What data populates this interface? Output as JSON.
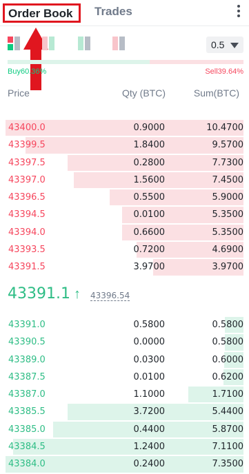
{
  "tabs": {
    "order_book": "Order Book",
    "trades": "Trades"
  },
  "tick_size": "0.5",
  "ratio": {
    "buy_label": "Buy60.36%",
    "sell_label": "Sell39.64%",
    "buy_pct": 60.36,
    "sell_pct": 39.64
  },
  "columns": {
    "price": "Price",
    "qty": "Qty (BTC)",
    "sum": "Sum(BTC)"
  },
  "asks": [
    {
      "price": "43400.0",
      "qty": "0.9000",
      "sum": "10.4700",
      "depth": 1.0
    },
    {
      "price": "43399.5",
      "qty": "1.8400",
      "sum": "9.5700",
      "depth": 0.915
    },
    {
      "price": "43397.5",
      "qty": "0.2800",
      "sum": "7.7300",
      "depth": 0.738
    },
    {
      "price": "43397.0",
      "qty": "1.5600",
      "sum": "7.4500",
      "depth": 0.712
    },
    {
      "price": "43396.5",
      "qty": "0.5500",
      "sum": "5.9000",
      "depth": 0.563
    },
    {
      "price": "43394.5",
      "qty": "0.0100",
      "sum": "5.3500",
      "depth": 0.511
    },
    {
      "price": "43394.0",
      "qty": "0.6600",
      "sum": "5.3500",
      "depth": 0.511
    },
    {
      "price": "43393.5",
      "qty": "0.7200",
      "sum": "4.6900",
      "depth": 0.448
    },
    {
      "price": "43391.5",
      "qty": "3.9700",
      "sum": "3.9700",
      "depth": 0.379
    }
  ],
  "last_price": {
    "value": "43391.1",
    "direction": "up",
    "arrow": "↑",
    "mark_price": "43396.54",
    "color": "#2ebd85"
  },
  "bids": [
    {
      "price": "43391.0",
      "qty": "0.5800",
      "sum": "0.5800",
      "depth": 0.079
    },
    {
      "price": "43390.5",
      "qty": "0.0000",
      "sum": "0.5800",
      "depth": 0.079
    },
    {
      "price": "43389.0",
      "qty": "0.0300",
      "sum": "0.6000",
      "depth": 0.082
    },
    {
      "price": "43387.5",
      "qty": "0.0100",
      "sum": "0.6200",
      "depth": 0.084
    },
    {
      "price": "43387.0",
      "qty": "1.1000",
      "sum": "1.7100",
      "depth": 0.233
    },
    {
      "price": "43385.5",
      "qty": "3.7200",
      "sum": "5.4400",
      "depth": 0.74
    },
    {
      "price": "43385.0",
      "qty": "0.4400",
      "sum": "5.8700",
      "depth": 0.799
    },
    {
      "price": "43384.5",
      "qty": "1.2400",
      "sum": "7.1100",
      "depth": 0.967
    },
    {
      "price": "43384.0",
      "qty": "0.2400",
      "sum": "7.3500",
      "depth": 1.0
    }
  ],
  "colors": {
    "sell": "#f6465d",
    "buy": "#2ebd85",
    "annotation": "#e0161f"
  },
  "icons": {
    "view_both": "book-view-both-icon",
    "view_bids": "book-view-bids-icon",
    "view_buy_sell": "book-view-split-icon",
    "view_asks": "book-view-asks-icon",
    "more": "more-vertical-icon",
    "tick_caret": "caret-down-icon",
    "annotation": "red-up-arrow"
  }
}
